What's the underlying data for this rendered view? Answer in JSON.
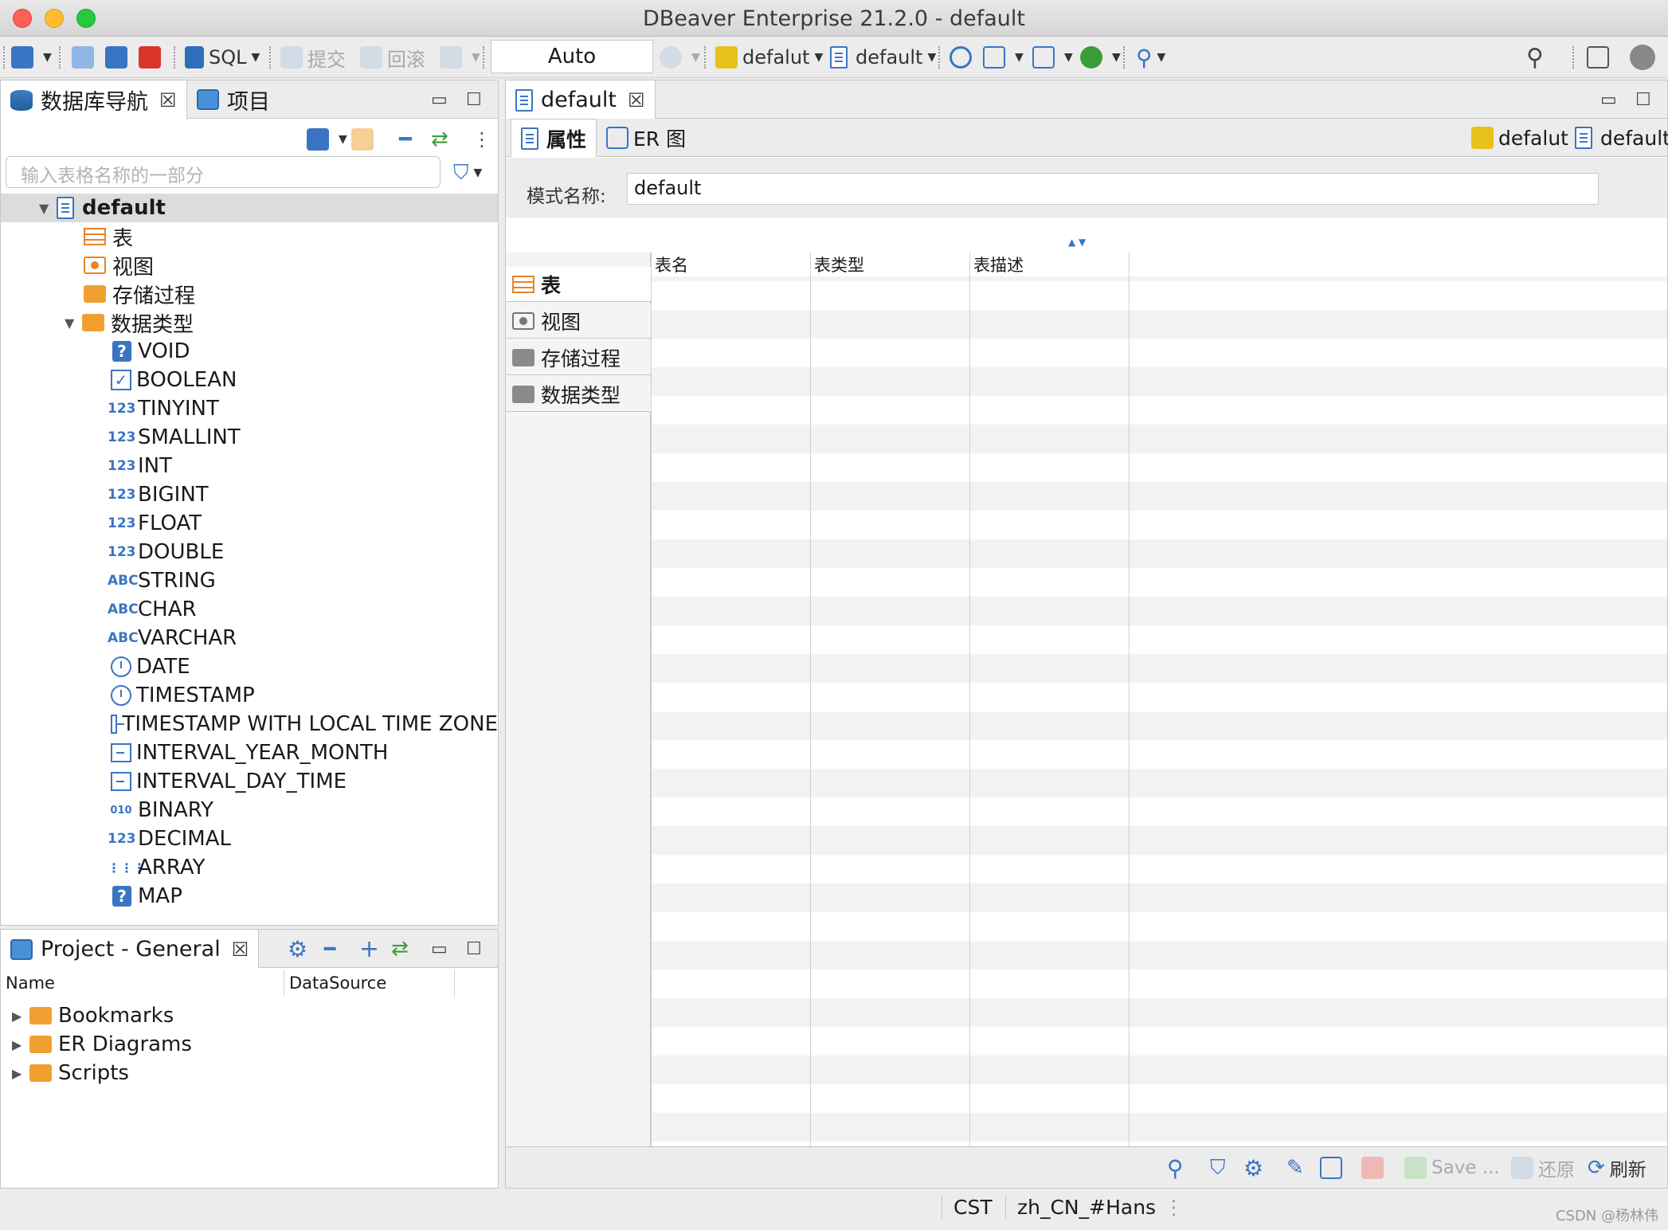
{
  "window": {
    "title": "DBeaver Enterprise 21.2.0 - default"
  },
  "toolbar": {
    "sql_label": "SQL",
    "commit_label": "提交",
    "rollback_label": "回滚",
    "transaction_mode": "Auto",
    "datasource_label": "defalut",
    "schema_label": "default"
  },
  "navigator": {
    "tab_label": "数据库导航",
    "projects_tab_label": "项目",
    "filter_placeholder": "输入表格名称的一部分",
    "selected_node": "default",
    "children": [
      {
        "label": "表",
        "icon": "table-icon"
      },
      {
        "label": "视图",
        "icon": "view-icon"
      },
      {
        "label": "存储过程",
        "icon": "folder-icon"
      },
      {
        "label": "数据类型",
        "icon": "folder-icon"
      }
    ],
    "data_types": [
      {
        "label": "VOID",
        "icon": "question-icon"
      },
      {
        "label": "BOOLEAN",
        "icon": "checkbox-icon"
      },
      {
        "label": "TINYINT",
        "icon": "number-icon"
      },
      {
        "label": "SMALLINT",
        "icon": "number-icon"
      },
      {
        "label": "INT",
        "icon": "number-icon"
      },
      {
        "label": "BIGINT",
        "icon": "number-icon"
      },
      {
        "label": "FLOAT",
        "icon": "number-icon"
      },
      {
        "label": "DOUBLE",
        "icon": "number-icon"
      },
      {
        "label": "STRING",
        "icon": "text-icon"
      },
      {
        "label": "CHAR",
        "icon": "text-icon"
      },
      {
        "label": "VARCHAR",
        "icon": "text-icon"
      },
      {
        "label": "DATE",
        "icon": "clock-icon"
      },
      {
        "label": "TIMESTAMP",
        "icon": "clock-icon"
      },
      {
        "label": "TIMESTAMP WITH LOCAL TIME ZONE",
        "icon": "timestamp-icon"
      },
      {
        "label": "INTERVAL_YEAR_MONTH",
        "icon": "timestamp-icon"
      },
      {
        "label": "INTERVAL_DAY_TIME",
        "icon": "timestamp-icon"
      },
      {
        "label": "BINARY",
        "icon": "binary-icon"
      },
      {
        "label": "DECIMAL",
        "icon": "number-icon"
      },
      {
        "label": "ARRAY",
        "icon": "array-icon"
      },
      {
        "label": "MAP",
        "icon": "question-icon"
      }
    ],
    "number_glyph": "123",
    "text_glyph": "ABC",
    "binary_glyph": "010"
  },
  "project": {
    "tab_label": "Project - General",
    "columns": [
      "Name",
      "DataSource"
    ],
    "items": [
      "Bookmarks",
      "ER Diagrams",
      "Scripts"
    ]
  },
  "editor": {
    "tab_label": "default",
    "subtabs": {
      "properties": "属性",
      "er": "ER 图"
    },
    "context_datasource": "defalut",
    "context_schema": "default",
    "schema_name_label": "模式名称:",
    "schema_name_value": "default",
    "left_tabs": [
      "表",
      "视图",
      "存储过程",
      "数据类型"
    ],
    "grid_columns": [
      "表名",
      "表类型",
      "表描述"
    ],
    "bottom": {
      "save": "Save ...",
      "revert": "还原",
      "refresh": "刷新"
    }
  },
  "status": {
    "timezone": "CST",
    "locale": "zh_CN_#Hans"
  },
  "watermark": "CSDN @杨林伟",
  "colors": {
    "accent": "#3a75c4",
    "folder": "#f0a030",
    "selection": "#dcdcdc"
  }
}
